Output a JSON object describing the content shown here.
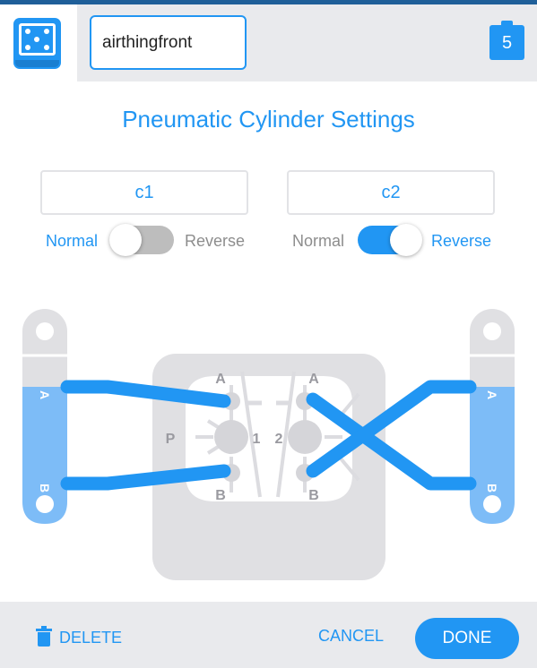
{
  "header": {
    "board_name": "airthingfront",
    "badge_count": "5",
    "board_icon": "board-icon",
    "clipboard_icon": "clipboard-icon"
  },
  "title": "Pneumatic Cylinder Settings",
  "cylinders": [
    {
      "name": "c1",
      "left_label": "Normal",
      "right_label": "Reverse",
      "reversed": false
    },
    {
      "name": "c2",
      "left_label": "Normal",
      "right_label": "Reverse",
      "reversed": true
    }
  ],
  "diagram": {
    "port_a": "A",
    "port_b": "B",
    "valve_p": "P",
    "valve_1": "1",
    "valve_2": "2"
  },
  "footer": {
    "delete_label": "DELETE",
    "cancel_label": "CANCEL",
    "done_label": "DONE",
    "delete_icon": "trash-icon"
  },
  "colors": {
    "accent": "#2196f3",
    "cylinder_fill": "#7dbcf7",
    "manifold": "#e0e0e3",
    "header_bg": "#e9eaed"
  }
}
